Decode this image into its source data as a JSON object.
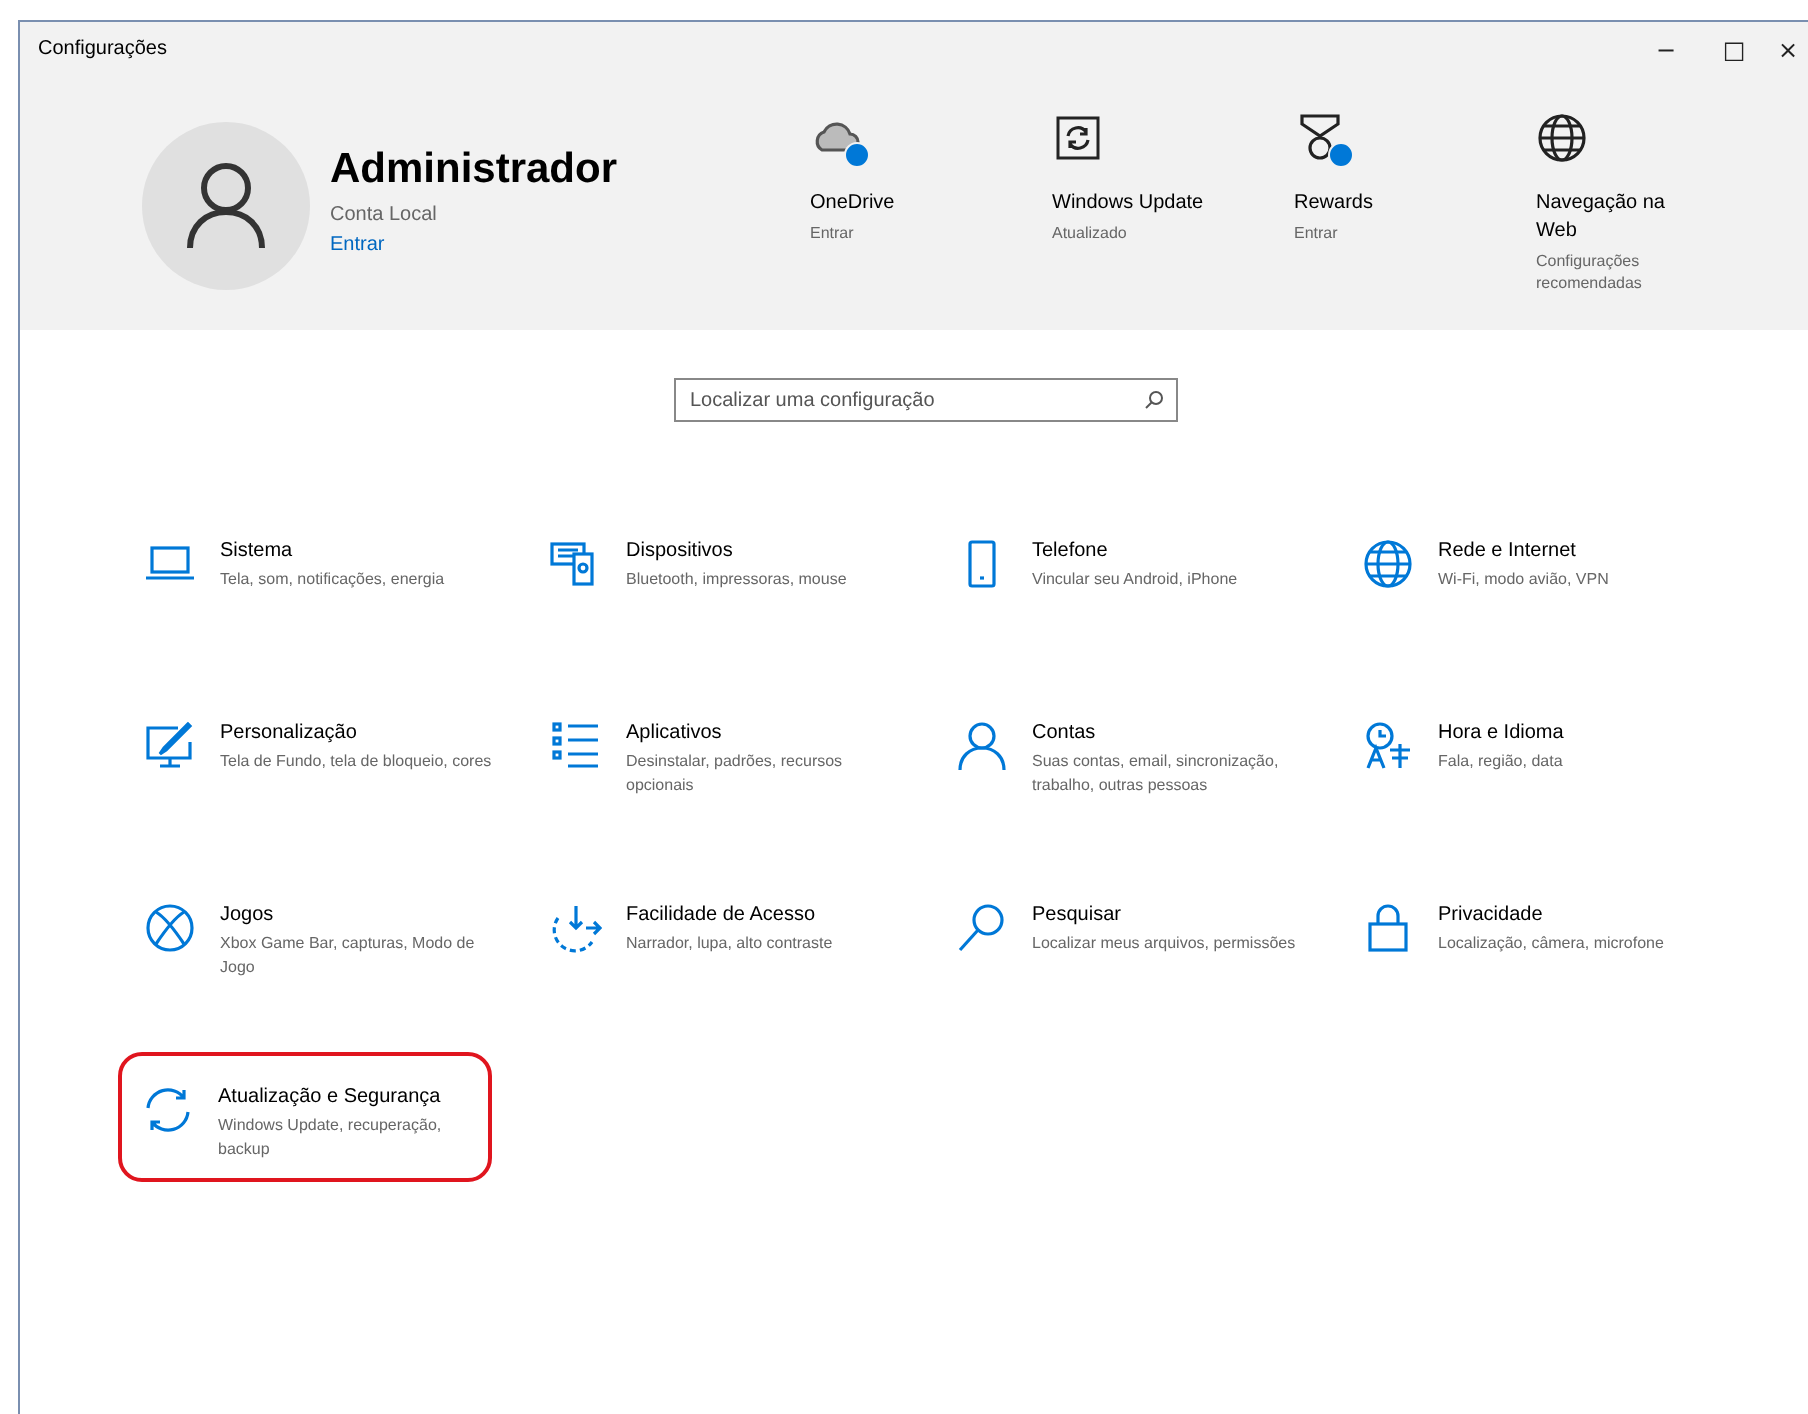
{
  "window": {
    "title": "Configurações",
    "controls": [
      "−",
      "□",
      "×"
    ]
  },
  "account": {
    "name": "Administrador",
    "type": "Conta Local",
    "link": "Entrar"
  },
  "quick_links": [
    {
      "title": "OneDrive",
      "subtitle": "Entrar",
      "badge": true
    },
    {
      "title": "Windows Update",
      "subtitle": "Atualizado",
      "badge": false
    },
    {
      "title": "Rewards",
      "subtitle": "Entrar",
      "badge": true
    },
    {
      "title": "Navegação na Web",
      "subtitle": "Configurações recomendadas",
      "badge": false
    }
  ],
  "search": {
    "placeholder": "Localizar uma configuração"
  },
  "categories": [
    {
      "title": "Sistema",
      "description": "Tela, som, notificações, energia",
      "highlighted": false
    },
    {
      "title": "Dispositivos",
      "description": "Bluetooth, impressoras, mouse",
      "highlighted": false
    },
    {
      "title": "Telefone",
      "description": "Vincular seu Android, iPhone",
      "highlighted": false
    },
    {
      "title": "Rede e Internet",
      "description": "Wi-Fi, modo avião, VPN",
      "highlighted": false
    },
    {
      "title": "Personalização",
      "description": "Tela de Fundo, tela de bloqueio, cores",
      "highlighted": false
    },
    {
      "title": "Aplicativos",
      "description": "Desinstalar, padrões, recursos opcionais",
      "highlighted": false
    },
    {
      "title": "Contas",
      "description": "Suas contas, email, sincronização, trabalho, outras pessoas",
      "highlighted": false
    },
    {
      "title": "Hora e Idioma",
      "description": "Fala, região, data",
      "highlighted": false
    },
    {
      "title": "Jogos",
      "description": "Xbox Game Bar, capturas, Modo de Jogo",
      "highlighted": false
    },
    {
      "title": "Facilidade de Acesso",
      "description": "Narrador, lupa, alto contraste",
      "highlighted": false
    },
    {
      "title": "Pesquisar",
      "description": "Localizar meus arquivos, permissões",
      "highlighted": false
    },
    {
      "title": "Privacidade",
      "description": "Localização, câmera, microfone",
      "highlighted": false
    },
    {
      "title": "Atualização e Segurança",
      "description": "Windows Update, recuperação, backup",
      "highlighted": true
    }
  ]
}
